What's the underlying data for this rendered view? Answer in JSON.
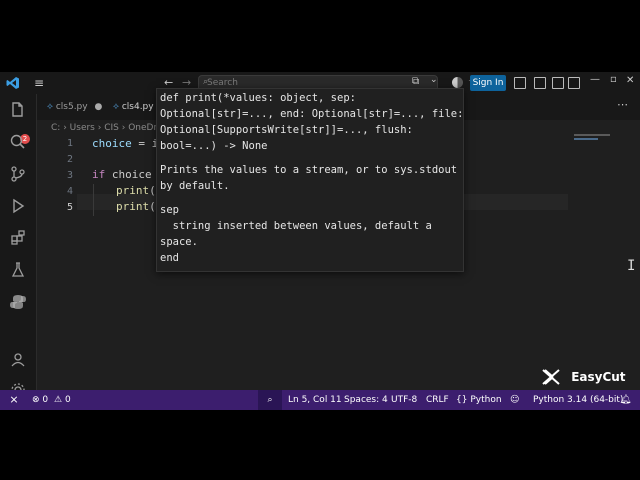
{
  "search": {
    "placeholder": "Search"
  },
  "header": {
    "sign_in": "Sign In"
  },
  "activity": {
    "badge_count": "2"
  },
  "tabs": [
    {
      "label": "cls5.py"
    },
    {
      "label": "cls4.py"
    }
  ],
  "breadcrumb": [
    "C:",
    "Users",
    "CIS",
    "OneDr"
  ],
  "editor": {
    "line_numbers": [
      "1",
      "2",
      "3",
      "4",
      "5"
    ],
    "active_line": "5",
    "lines": {
      "l1_var": "choice",
      "l1_rest": " = i",
      "l3_kw": "if",
      "l3_rest": " choice",
      "l4_fn": "print",
      "l4_rest": "(",
      "l5_fn": "print",
      "l5_rest": "("
    }
  },
  "hover": {
    "sig1": "def print(*values: object, sep:",
    "sig2": "Optional[str]=..., end: Optional[str]=..., file:",
    "sig3": "Optional[SupportsWrite[str]]=..., flush:",
    "sig4": "bool=...) -> None",
    "desc1": "Prints the values to a stream, or to sys.stdout",
    "desc2": "by default.",
    "param_name": "sep",
    "param_desc1": "  string inserted between values, default a",
    "param_desc2": "space.",
    "param_next": "end"
  },
  "status": {
    "errors": "0",
    "warnings": "0",
    "position": "Ln 5, Col 11",
    "spaces": "Spaces: 4",
    "encoding": "UTF-8",
    "eol": "CRLF",
    "language": "Python",
    "interpreter": "Python 3.14 (64-bit)"
  },
  "watermark": {
    "text": "EasyCut"
  },
  "colors": {
    "accent": "#0e639c",
    "statusbar": "#3c1e6e",
    "editor_bg": "#1f1f1f"
  }
}
